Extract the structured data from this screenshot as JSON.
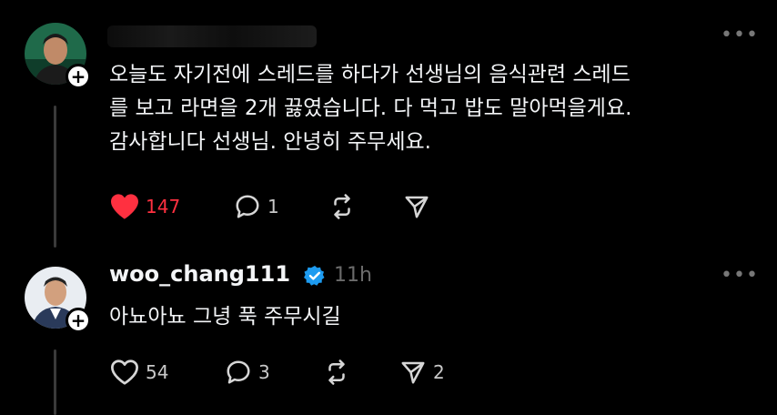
{
  "posts": [
    {
      "username": "",
      "time": "",
      "more_label": "•••",
      "text_lines": [
        "오늘도 자기전에 스레드를 하다가 선생님의 음식관련 스레드",
        "를 보고 라면을 2개 끓였습니다. 다 먹고 밥도 말아먹을게요.",
        "감사합니다 선생님. 안녕히 주무세요."
      ],
      "likes": "147",
      "replies": "1",
      "reposts": "",
      "shares": "",
      "liked": true,
      "like_color": "#ff3040"
    },
    {
      "username": "woo_chang111",
      "verified": true,
      "verified_color": "#1d9bf0",
      "time": "11h",
      "more_label": "•••",
      "text_lines": [
        "아뇨아뇨 그녕 푹 주무시길"
      ],
      "likes": "54",
      "replies": "3",
      "reposts": "",
      "shares": "2",
      "liked": false
    }
  ],
  "follow_label": "+"
}
